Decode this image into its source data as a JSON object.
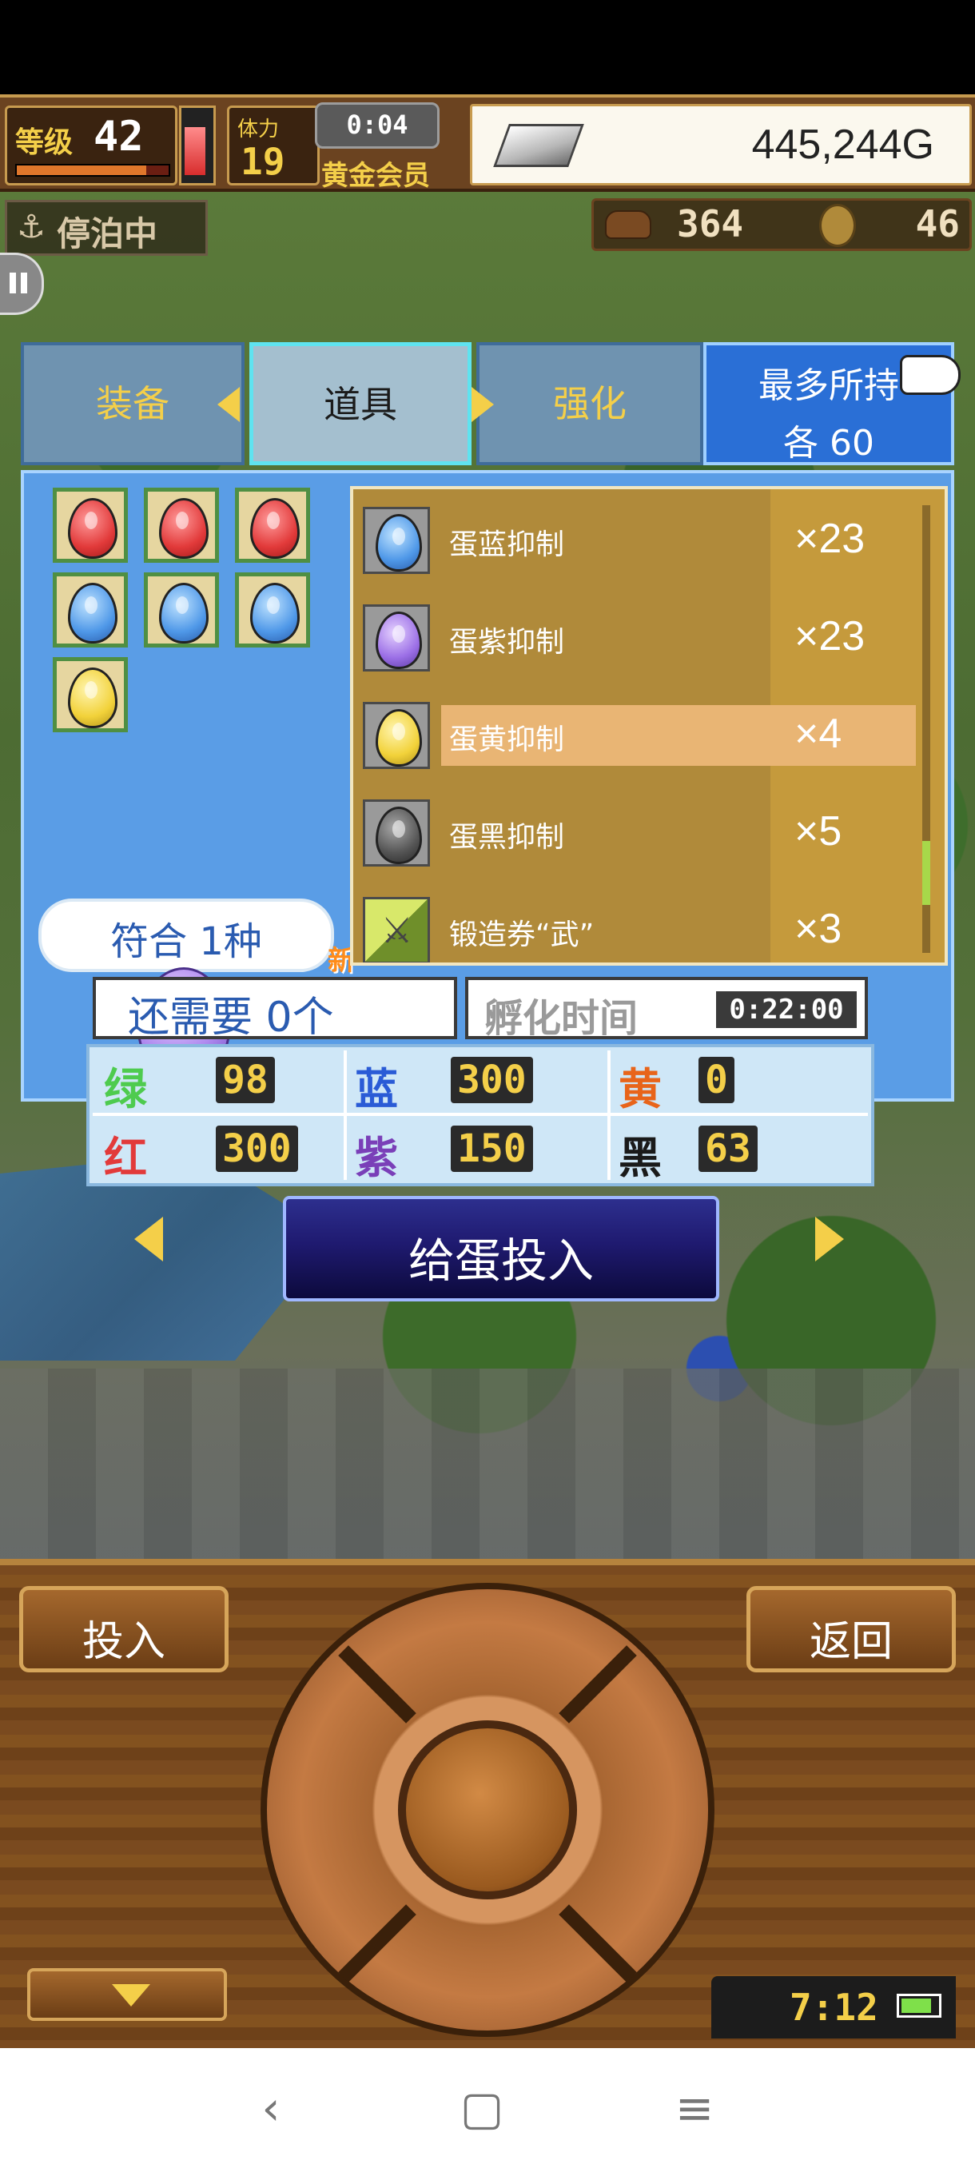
{
  "hud": {
    "level_label": "等级",
    "level": "42",
    "xp_fraction": 0.85,
    "hp_fraction": 0.75,
    "stat_label": "体力",
    "stat_value": "19",
    "clock": "0:04",
    "membership": "黄金会员",
    "gold": "445,244G"
  },
  "status_row": {
    "moored": "停泊中",
    "moored_icon": "anchor-icon",
    "resource1": "364",
    "resource2": "46"
  },
  "tabs": [
    {
      "label": "装备",
      "active": false
    },
    {
      "label": "道具",
      "active": true
    },
    {
      "label": "强化",
      "active": false
    }
  ],
  "max_hold": {
    "title": "最多所持",
    "each": "各  60"
  },
  "owned_eggs": [
    "red",
    "red",
    "red",
    "blue",
    "blue",
    "blue",
    "yellow"
  ],
  "match_text": "符合 1种",
  "new_badge": "新",
  "items": [
    {
      "name": "蛋蓝抑制",
      "qty": "×23",
      "egg": "blue"
    },
    {
      "name": "蛋紫抑制",
      "qty": "×23",
      "egg": "purple"
    },
    {
      "name": "蛋黄抑制",
      "qty": "×4",
      "egg": "yellow",
      "selected": true
    },
    {
      "name": "蛋黑抑制",
      "qty": "×5",
      "egg": "black"
    },
    {
      "name": "锻造券“武”",
      "qty": "×3",
      "icon": "sword-ticket-icon"
    }
  ],
  "requirement": {
    "need": "还需要 0个",
    "hatch_label": "孵化时间",
    "hatch_time": "0:22:00",
    "cells": [
      {
        "label": "绿",
        "value": "98",
        "color": "#4ecb4e"
      },
      {
        "label": "蓝",
        "value": "300",
        "color": "#2a5bd6"
      },
      {
        "label": "黄",
        "value": "0",
        "color": "#e8641a"
      },
      {
        "label": "红",
        "value": "300",
        "color": "#e23a3a"
      },
      {
        "label": "紫",
        "value": "150",
        "color": "#7a3fb8"
      },
      {
        "label": "黑",
        "value": "63",
        "color": "#1a1a1a"
      }
    ]
  },
  "action_button": "给蛋投入",
  "controls": {
    "insert": "投入",
    "back": "返回",
    "device_time": "7:12",
    "battery_fraction": 0.85
  },
  "nav": {
    "back": "‹",
    "home": "▢",
    "menu": "≡"
  }
}
